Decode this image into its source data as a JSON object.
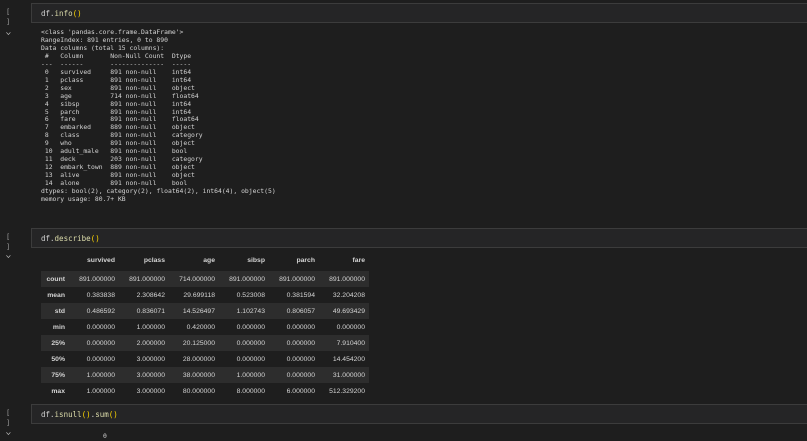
{
  "cells": [
    {
      "code_obj": "df",
      "code_fn": "info",
      "code_open": "(",
      "code_close": ")"
    },
    {
      "code_obj": "df",
      "code_fn": "describe",
      "code_open": "(",
      "code_close": ")"
    },
    {
      "code_obj": "df",
      "code_fn": "isnull",
      "code_open": "()",
      "code_fn2": "sum",
      "code_close": "()"
    }
  ],
  "gutter_icon": "[ ]",
  "info_output": "<class 'pandas.core.frame.DataFrame'>\nRangeIndex: 891 entries, 0 to 890\nData columns (total 15 columns):\n #   Column       Non-Null Count  Dtype   \n---  ------       --------------  -----   \n 0   survived     891 non-null    int64   \n 1   pclass       891 non-null    int64   \n 2   sex          891 non-null    object  \n 3   age          714 non-null    float64 \n 4   sibsp        891 non-null    int64   \n 5   parch        891 non-null    int64   \n 6   fare         891 non-null    float64 \n 7   embarked     889 non-null    object  \n 8   class        891 non-null    category\n 9   who          891 non-null    object  \n 10  adult_male   891 non-null    bool    \n 11  deck         203 non-null    category\n 12  embark_town  889 non-null    object  \n 13  alive        891 non-null    object  \n 14  alone        891 non-null    bool    \ndtypes: bool(2), category(2), float64(2), int64(4), object(5)\nmemory usage: 80.7+ KB",
  "describe": {
    "columns": [
      "survived",
      "pclass",
      "age",
      "sibsp",
      "parch",
      "fare"
    ],
    "rows": [
      {
        "label": "count",
        "values": [
          "891.000000",
          "891.000000",
          "714.000000",
          "891.000000",
          "891.000000",
          "891.000000"
        ]
      },
      {
        "label": "mean",
        "values": [
          "0.383838",
          "2.308642",
          "29.699118",
          "0.523008",
          "0.381594",
          "32.204208"
        ]
      },
      {
        "label": "std",
        "values": [
          "0.486592",
          "0.836071",
          "14.526497",
          "1.102743",
          "0.806057",
          "49.693429"
        ]
      },
      {
        "label": "min",
        "values": [
          "0.000000",
          "1.000000",
          "0.420000",
          "0.000000",
          "0.000000",
          "0.000000"
        ]
      },
      {
        "label": "25%",
        "values": [
          "0.000000",
          "2.000000",
          "20.125000",
          "0.000000",
          "0.000000",
          "7.910400"
        ]
      },
      {
        "label": "50%",
        "values": [
          "0.000000",
          "3.000000",
          "28.000000",
          "0.000000",
          "0.000000",
          "14.454200"
        ]
      },
      {
        "label": "75%",
        "values": [
          "1.000000",
          "3.000000",
          "38.000000",
          "1.000000",
          "0.000000",
          "31.000000"
        ]
      },
      {
        "label": "max",
        "values": [
          "1.000000",
          "3.000000",
          "80.000000",
          "8.000000",
          "6.000000",
          "512.329200"
        ]
      }
    ]
  },
  "isnull_partial": "0"
}
